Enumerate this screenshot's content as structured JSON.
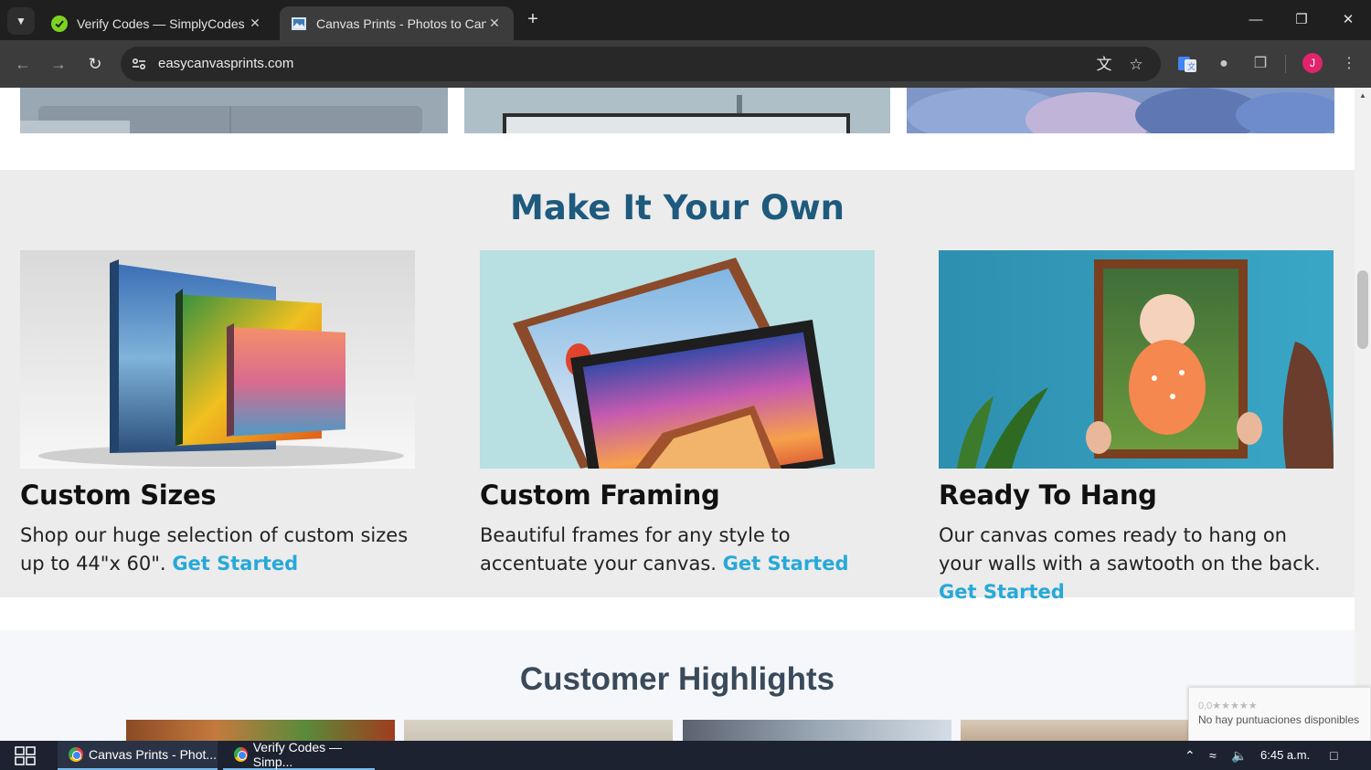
{
  "browser": {
    "tabs": [
      {
        "title": "Verify Codes — SimplyCodes",
        "active": false
      },
      {
        "title": "Canvas Prints - Photos to Canvas",
        "active": true
      }
    ],
    "new_tab": "+",
    "url": "easycanvasprints.com",
    "profile_initial": "J",
    "accent": "#e0246b"
  },
  "page": {
    "section_title": "Make It Your Own",
    "cards": [
      {
        "title": "Custom Sizes",
        "text": "Shop our huge selection of custom sizes up to 44\"x 60\".",
        "link": "Get Started"
      },
      {
        "title": "Custom Framing",
        "text": "Beautiful frames for any style to accentuate your canvas.",
        "link": "Get Started"
      },
      {
        "title": "Ready To Hang",
        "text": "Our canvas comes ready to hang on your walls with a sawtooth on the back.",
        "link": "Get Started"
      }
    ],
    "highlights_title": "Customer Highlights",
    "heading_color": "#1e5a7d",
    "link_color": "#27a9d8"
  },
  "recaptcha": {
    "rating": "0,0★★★★★",
    "text": "No hay puntuaciones disponibles"
  },
  "taskbar": {
    "apps": [
      {
        "label": "Canvas Prints - Phot..."
      },
      {
        "label": "Verify Codes — Simp..."
      }
    ],
    "time": "6:45 a.m."
  }
}
